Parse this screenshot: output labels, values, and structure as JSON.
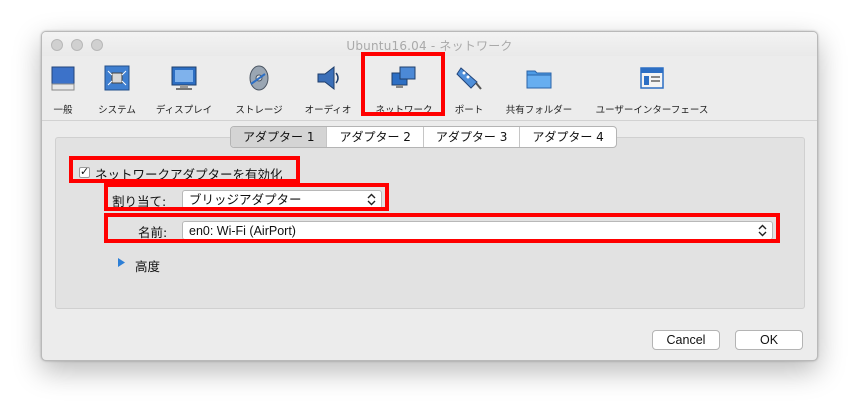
{
  "window": {
    "title": "Ubuntu16.04 - ネットワーク"
  },
  "toolbar": {
    "items": [
      {
        "label": "一般",
        "icon": "general-icon"
      },
      {
        "label": "システム",
        "icon": "system-chip-icon"
      },
      {
        "label": "ディスプレイ",
        "icon": "display-monitor-icon"
      },
      {
        "label": "ストレージ",
        "icon": "storage-disk-icon"
      },
      {
        "label": "オーディオ",
        "icon": "audio-speaker-icon"
      },
      {
        "label": "ネットワーク",
        "icon": "network-icon"
      },
      {
        "label": "ポート",
        "icon": "port-connector-icon"
      },
      {
        "label": "共有フォルダー",
        "icon": "shared-folder-icon"
      },
      {
        "label": "ユーザーインターフェース",
        "icon": "user-interface-icon"
      }
    ],
    "selected": "ネットワーク"
  },
  "adapter_tabs": [
    "アダプター 1",
    "アダプター 2",
    "アダプター 3",
    "アダプター 4"
  ],
  "network": {
    "enable_label": "ネットワークアダプターを有効化",
    "enable_checked": true,
    "attached_label": "割り当て:",
    "attached_value": "ブリッジアダプター",
    "name_label": "名前:",
    "name_value": "en0: Wi-Fi (AirPort)",
    "advanced_label": "高度"
  },
  "buttons": {
    "cancel": "Cancel",
    "ok": "OK"
  },
  "colors": {
    "highlight": "#ff0000",
    "accent": "#2d7fd6"
  }
}
